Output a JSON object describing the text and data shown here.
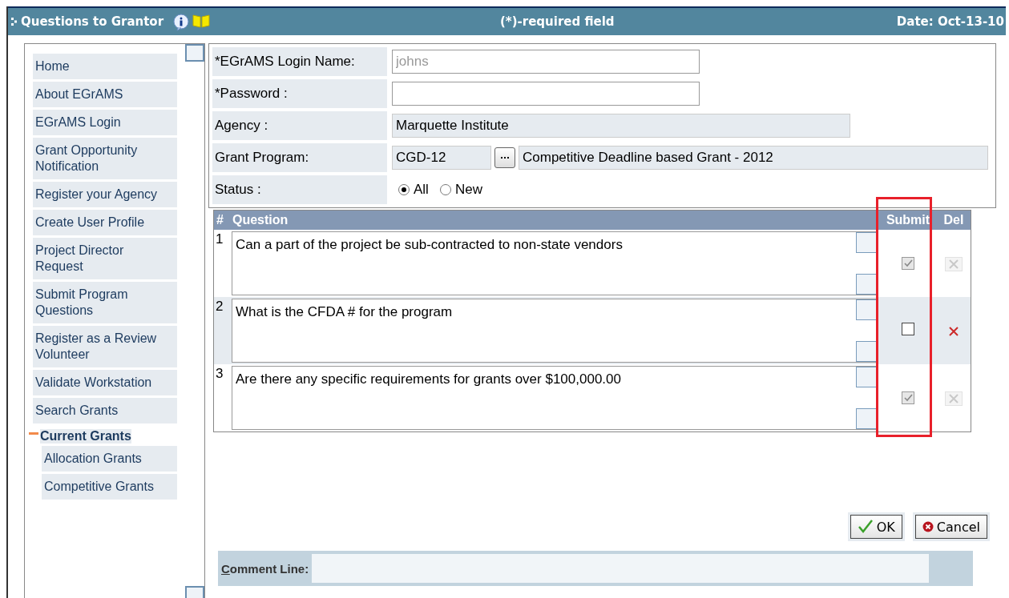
{
  "header": {
    "title": "Questions to Grantor",
    "note": "(*)-required field",
    "date": "Date: Oct-13-10"
  },
  "sidebar": {
    "items": [
      {
        "label": "Home"
      },
      {
        "label": "About EGrAMS"
      },
      {
        "label": "EGrAMS Login"
      },
      {
        "label": "Grant Opportunity Notification"
      },
      {
        "label": "Register your Agency"
      },
      {
        "label": "Create User Profile"
      },
      {
        "label": "Project Director Request"
      },
      {
        "label": "Submit Program Questions"
      },
      {
        "label": "Register as a Review Volunteer"
      },
      {
        "label": "Validate Workstation"
      },
      {
        "label": "Search Grants"
      },
      {
        "label": "Current Grants",
        "expanded": true,
        "children": [
          {
            "label": "Allocation Grants"
          },
          {
            "label": "Competitive Grants"
          }
        ]
      }
    ]
  },
  "form": {
    "login_name": {
      "label": "*EGrAMS Login Name:",
      "value": "johns",
      "disabled": true
    },
    "password": {
      "label": "*Password :"
    },
    "agency": {
      "label": "Agency :",
      "value": "Marquette Institute"
    },
    "grant_program": {
      "label": "Grant Program:",
      "code": "CGD-12",
      "name": "Competitive Deadline based Grant  - 2012"
    },
    "status": {
      "label": "Status :",
      "options": [
        {
          "label": "All",
          "selected": true
        },
        {
          "label": "New",
          "selected": false
        }
      ]
    }
  },
  "table": {
    "columns": [
      "#",
      "Question",
      "Submit",
      "Del"
    ],
    "submit_highlighted": true,
    "rows": [
      {
        "number": "1",
        "question": "Can a part of the project be sub-contracted to non-state vendors",
        "checked": true,
        "disabled": true
      },
      {
        "number": "2",
        "question": "What is the CFDA # for the program",
        "checked": false,
        "disabled": false
      },
      {
        "number": "3",
        "question": "Are there any specific requirements for grants over $100,000.00",
        "checked": true,
        "disabled": true
      }
    ]
  },
  "buttons": [
    {
      "kind": "ok",
      "label": "OK"
    },
    {
      "kind": "cancel",
      "label": "Cancel"
    }
  ],
  "comment": {
    "label": "Comment Line:",
    "accesskey_underlined": true
  }
}
